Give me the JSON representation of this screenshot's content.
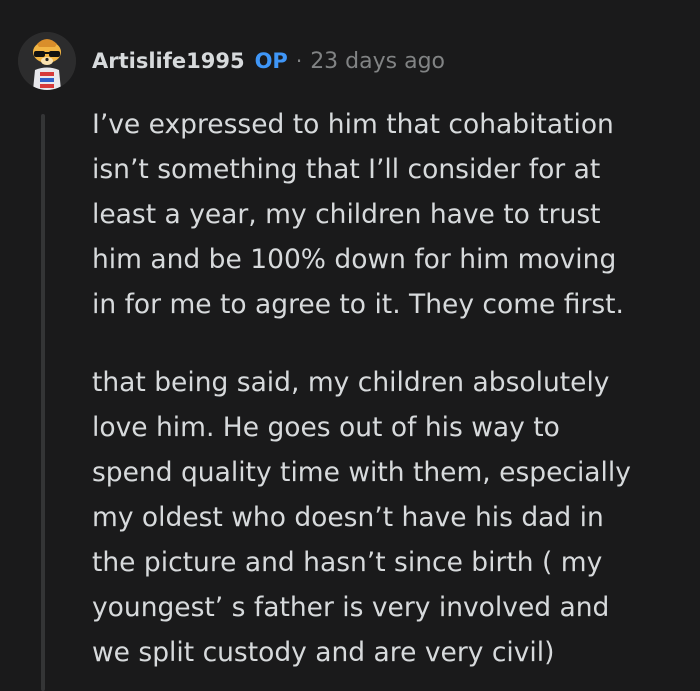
{
  "comment": {
    "author": "Artislife1995",
    "op_badge": "OP",
    "separator": "·",
    "timestamp": "23 days ago",
    "avatar_icon": "snoo-avatar-dog-sunglasses-icon",
    "paragraphs": [
      "I’ve expressed to him that cohabitation\nisn’t something that I’ll consider for at\nleast a year, my children have to trust\nhim and be 100% down for him moving\nin for me to agree to it. They come first.",
      "that being said, my children absolutely\nlove him. He goes out of his way to\nspend quality time with them, especially\nmy oldest who doesn’t have his dad in\nthe picture and hasn’t since birth ( my\nyoungest’ s father is very involved and\nwe split custody and are very civil)"
    ]
  },
  "colors": {
    "background": "#1a1a1b",
    "text": "#d7dadc",
    "meta": "#818384",
    "op": "#3f96f7",
    "thread_line": "#343536"
  }
}
